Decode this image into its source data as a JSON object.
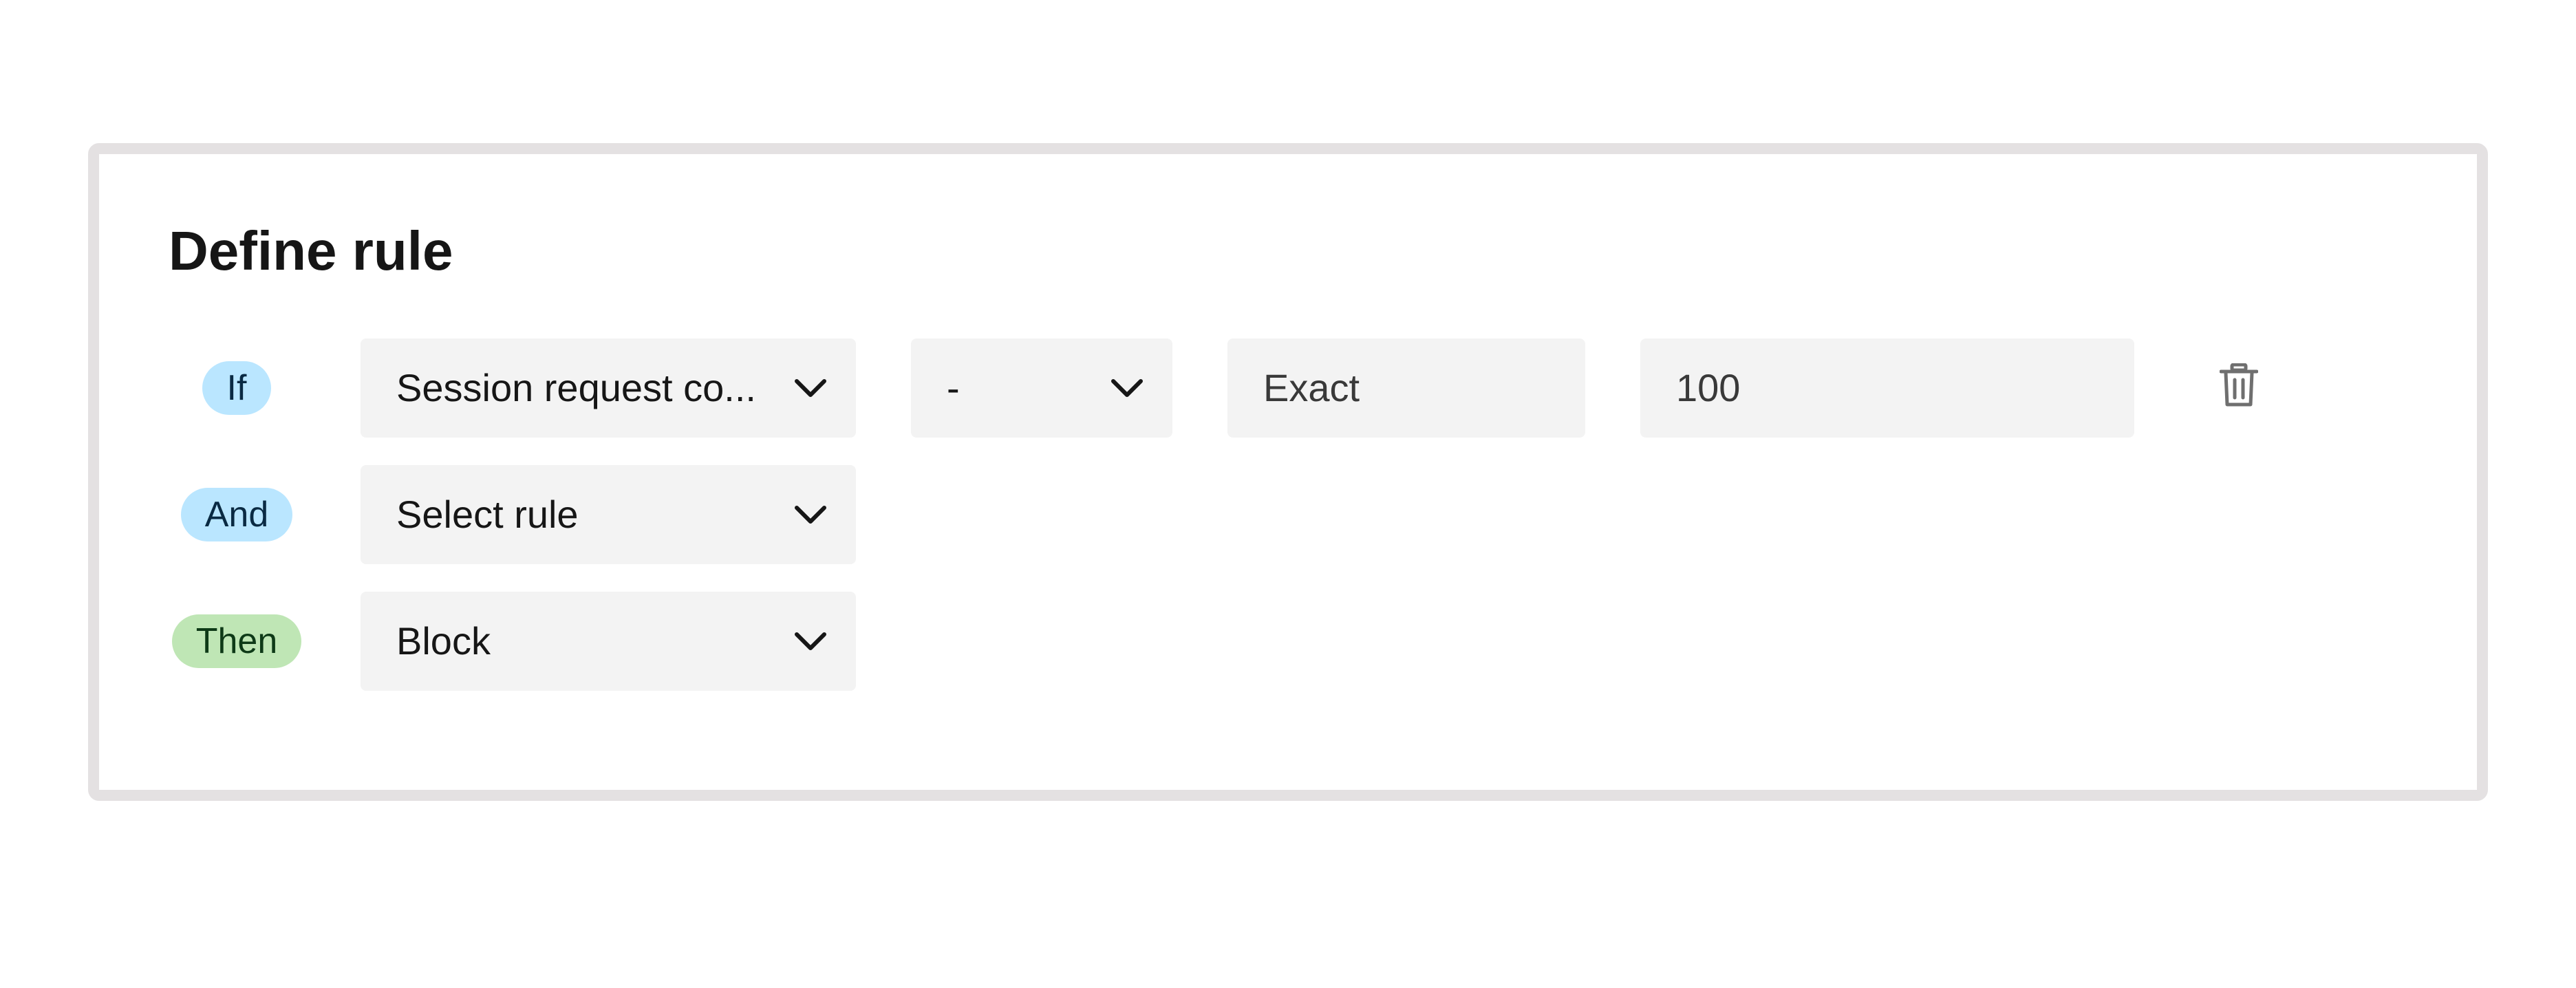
{
  "card": {
    "title": "Define rule"
  },
  "rows": {
    "if": {
      "tag": "If",
      "rule_select": "Session request co...",
      "operator_select": "-",
      "match_field": "Exact",
      "value_field": "100"
    },
    "and": {
      "tag": "And",
      "rule_select": "Select rule"
    },
    "then": {
      "tag": "Then",
      "action_select": "Block"
    }
  },
  "icons": {
    "dropdown": "chevron-down-icon",
    "delete": "trash-icon"
  },
  "colors": {
    "card_border": "#e4e1e2",
    "field_background": "#f3f3f3",
    "tag_blue": "#bae6ff",
    "tag_green": "#bfe6b5",
    "text": "#161616"
  }
}
